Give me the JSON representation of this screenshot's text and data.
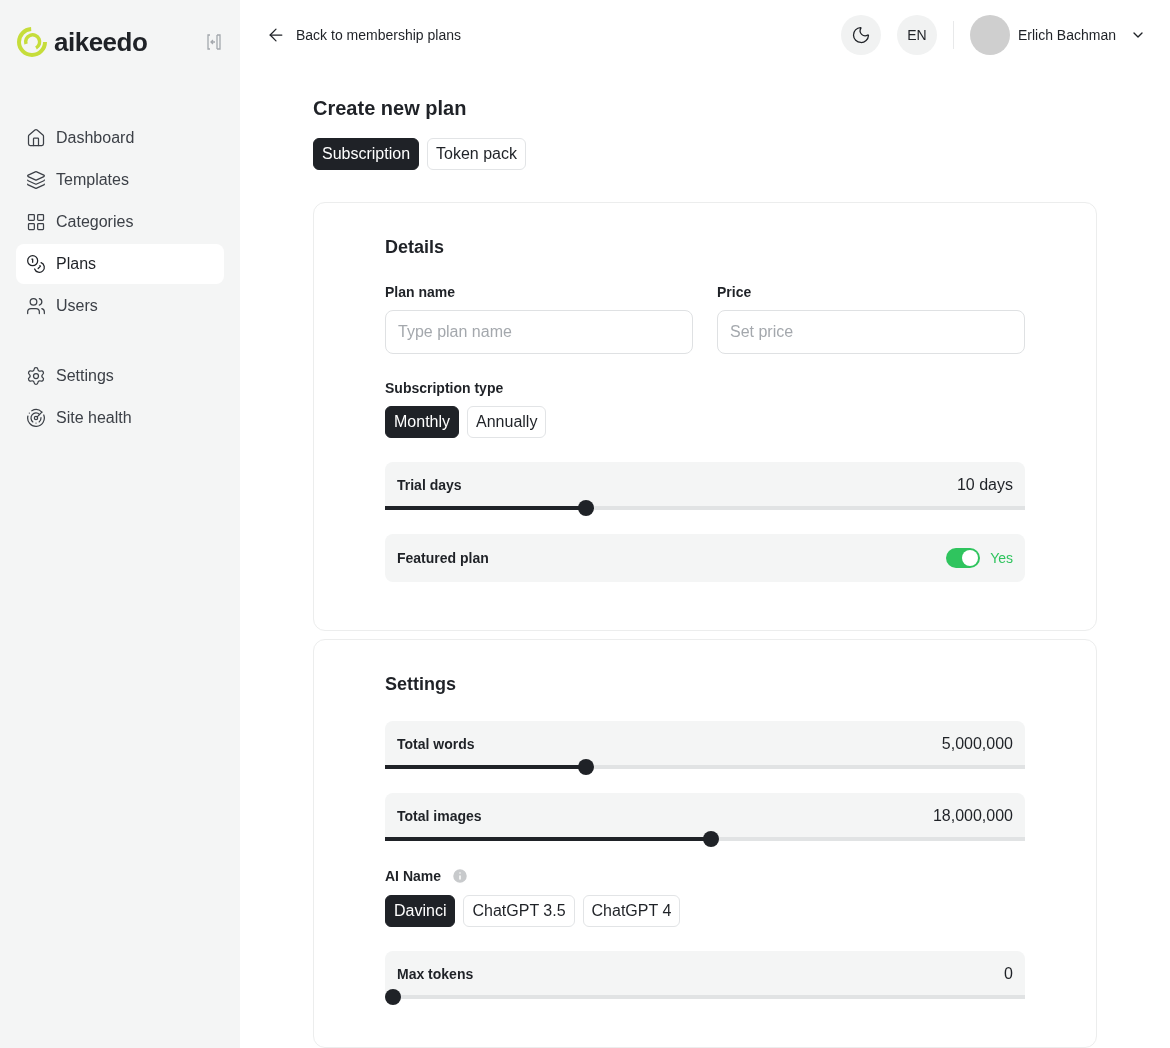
{
  "brand": {
    "name": "aikeedo"
  },
  "sidebar": {
    "items": [
      {
        "label": "Dashboard",
        "selected": false
      },
      {
        "label": "Templates",
        "selected": false
      },
      {
        "label": "Categories",
        "selected": false
      },
      {
        "label": "Plans",
        "selected": true
      },
      {
        "label": "Users",
        "selected": false
      }
    ],
    "bottom_items": [
      {
        "label": "Settings",
        "selected": false
      },
      {
        "label": "Site health",
        "selected": false
      }
    ]
  },
  "header": {
    "back_link": "Back to membership plans",
    "language": "EN",
    "user": {
      "name": "Erlich Bachman"
    }
  },
  "page_title": "Create new plan",
  "plan_tabs": [
    {
      "label": "Subscription",
      "selected": true
    },
    {
      "label": "Token pack",
      "selected": false
    }
  ],
  "details": {
    "title": "Details",
    "fields": [
      {
        "label": "Plan name",
        "placeholder": "Type plan name"
      },
      {
        "label": "Price",
        "placeholder": "Set price"
      }
    ],
    "subscription_type": {
      "label": "Subscription type",
      "options": [
        {
          "label": "Monthly",
          "selected": true
        },
        {
          "label": "Annually",
          "selected": false
        }
      ]
    },
    "trial": {
      "label": "Trial days",
      "reading": "10 days",
      "level": 0.31
    },
    "featured": {
      "label": "Featured plan",
      "on": true,
      "state_label": "Yes"
    }
  },
  "settings": {
    "title": "Settings",
    "sliders": [
      {
        "label": "Total words",
        "reading": "5,000,000",
        "level": 0.31
      },
      {
        "label": "Total images",
        "reading": "18,000,000",
        "level": 0.51
      }
    ],
    "ai_name": {
      "label": "AI Name",
      "options": [
        {
          "label": "Davinci",
          "selected": true
        },
        {
          "label": "ChatGPT 3.5",
          "selected": false
        },
        {
          "label": "ChatGPT 4",
          "selected": false
        }
      ]
    },
    "max_tokens": {
      "label": "Max tokens",
      "reading": "0",
      "level": 0
    }
  }
}
